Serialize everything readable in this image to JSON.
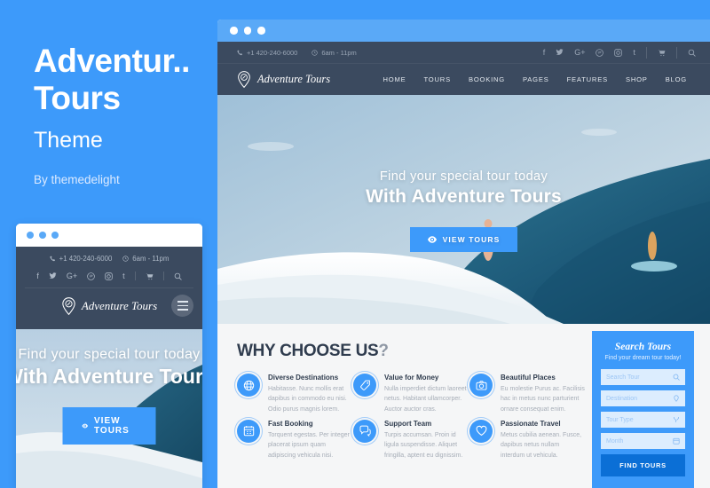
{
  "promo": {
    "title_line1": "Adventur..",
    "title_line2": "Tours",
    "subtitle": "Theme",
    "byline": "By themedelight"
  },
  "colors": {
    "brand_blue": "#3d9afa",
    "chrome_blue": "#5aa9f7",
    "dark_navy": "#3b4a5f",
    "section_bg": "#f5f6f7",
    "button_dark_blue": "#0b6fd6"
  },
  "topbar": {
    "phone": "+1 420-240-6000",
    "hours": "6am - 11pm",
    "social": [
      {
        "name": "facebook-icon",
        "glyph": "f"
      },
      {
        "name": "twitter-icon",
        "glyph": "✒"
      },
      {
        "name": "google-plus-icon",
        "glyph": "G+"
      },
      {
        "name": "pinterest-icon",
        "glyph": "Ⓟ"
      },
      {
        "name": "instagram-icon",
        "glyph": "▣"
      },
      {
        "name": "tumblr-icon",
        "glyph": "t"
      }
    ],
    "cart_icon": "cart-icon",
    "search_icon": "search-icon"
  },
  "brand": {
    "name": "Adventure Tours",
    "logo_icon": "compass-pin-icon"
  },
  "nav": {
    "items": [
      {
        "label": "HOME",
        "active": true
      },
      {
        "label": "TOURS",
        "active": false
      },
      {
        "label": "BOOKING",
        "active": false
      },
      {
        "label": "PAGES",
        "active": false
      },
      {
        "label": "FEATURES",
        "active": false
      },
      {
        "label": "SHOP",
        "active": false
      },
      {
        "label": "BLOG",
        "active": false
      }
    ]
  },
  "hero": {
    "line1": "Find your special tour today",
    "line2": "With Adventure Tours",
    "cta_label": "VIEW TOURS",
    "cta_icon": "eye-icon"
  },
  "why": {
    "title": "WHY CHOOSE US",
    "title_mark": "?",
    "features": [
      {
        "icon": "globe-icon",
        "heading": "Diverse Destinations",
        "text": "Habitasse. Nunc mollis erat dapibus in commodo eu nisi. Odio purus magnis lorem."
      },
      {
        "icon": "tag-icon",
        "heading": "Value for Money",
        "text": "Nulla imperdiet dictum laoreet netus. Habitant ullamcorper. Auctor auctor cras."
      },
      {
        "icon": "camera-icon",
        "heading": "Beautiful Places",
        "text": "Eu molestie Purus ac. Facilisis hac in metus nunc parturient ornare consequat enim."
      },
      {
        "icon": "calendar-icon",
        "heading": "Fast Booking",
        "text": "Torquent egestas. Per integer placerat ipsum quam adipiscing vehicula nisi."
      },
      {
        "icon": "chat-icon",
        "heading": "Support Team",
        "text": "Turpis accumsan. Proin id ligula suspendisse. Aliquet fringilla, aptent eu dignissim."
      },
      {
        "icon": "heart-icon",
        "heading": "Passionate Travel",
        "text": "Metus cubilia aenean. Fusce, dapibus netus nullam interdum ut vehicula."
      }
    ]
  },
  "search_widget": {
    "title": "Search Tours",
    "subtitle": "Find your dream tour today!",
    "fields": [
      {
        "placeholder": "Search Tour",
        "icon": "search-icon"
      },
      {
        "placeholder": "Destination",
        "icon": "map-pin-icon"
      },
      {
        "placeholder": "Tour Type",
        "icon": "tour-type-icon"
      },
      {
        "placeholder": "Month",
        "icon": "calendar-icon"
      }
    ],
    "submit_label": "FIND TOURS"
  },
  "mobile": {
    "hero_line1": "Find your special tour today",
    "hero_line2": "With Adventure Tours",
    "cta_label": "VIEW TOURS",
    "menu_icon": "hamburger-icon"
  }
}
